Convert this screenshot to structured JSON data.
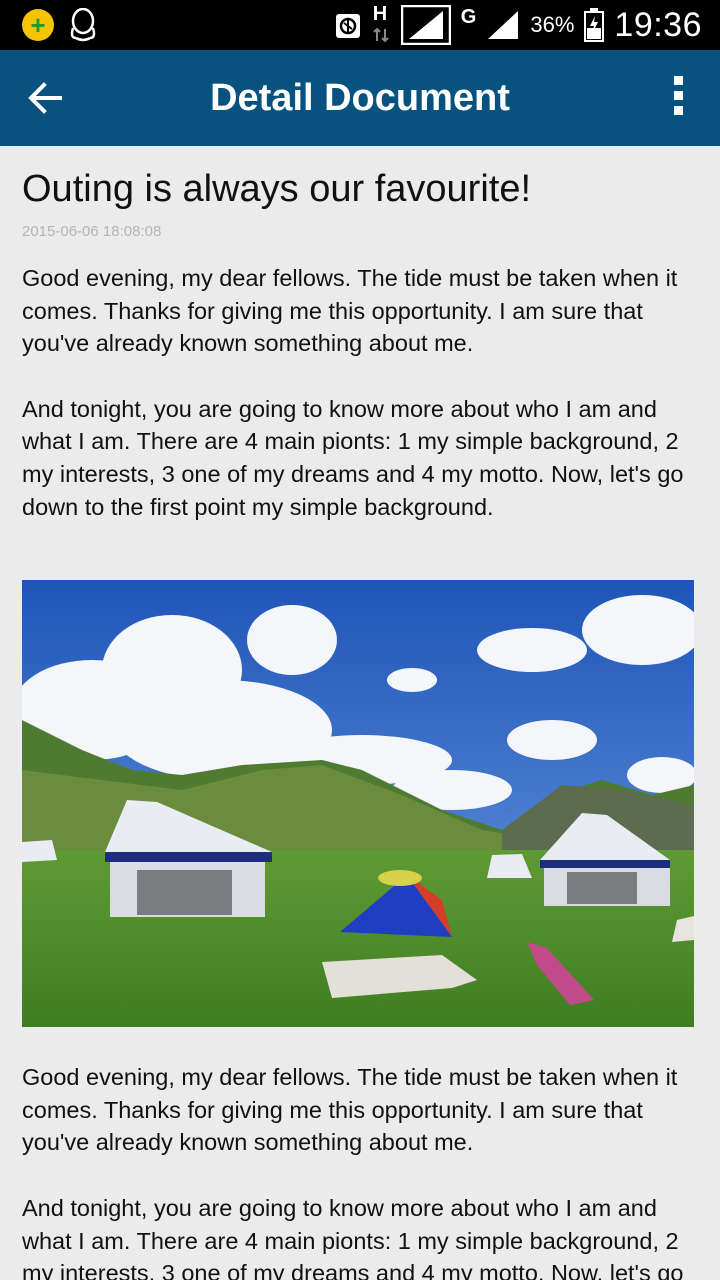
{
  "status_bar": {
    "battery": "36%",
    "time": "19:36",
    "network_h": "H",
    "network_g": "G"
  },
  "app_bar": {
    "title": "Detail Document"
  },
  "article": {
    "title": "Outing is always our favourite!",
    "date": "2015-06-06 18:08:08",
    "paragraphs_top": [
      "Good evening, my dear fellows. The tide must be taken when it comes. Thanks for giving me this opportunity. I am sure that you've already known something about me.",
      "And tonight, you are going to know more about who I am and what I am. There are 4 main pionts: 1 my simple background, 2 my interests, 3 one of my dreams and 4 my motto. Now, let's go down to the first point my simple background."
    ],
    "paragraphs_bottom": [
      "Good evening, my dear fellows. The tide must be taken when it comes. Thanks for giving me this opportunity. I am sure that you've already known something about me.",
      "And tonight, you are going to know more about who I am and what I am. There are 4 main pionts: 1 my simple background, 2 my interests, 3 one of my dreams and 4 my motto. Now, let's go down to the first point my simple background."
    ]
  },
  "colors": {
    "app_bar": "#07527e",
    "background": "#ebebeb",
    "sky": "#2a63c4",
    "grass": "#4f8a2a"
  },
  "icons": [
    "app-badge-icon",
    "qq-icon",
    "map-icon",
    "signal-icon",
    "battery-icon",
    "back-arrow-icon",
    "more-vert-icon"
  ]
}
